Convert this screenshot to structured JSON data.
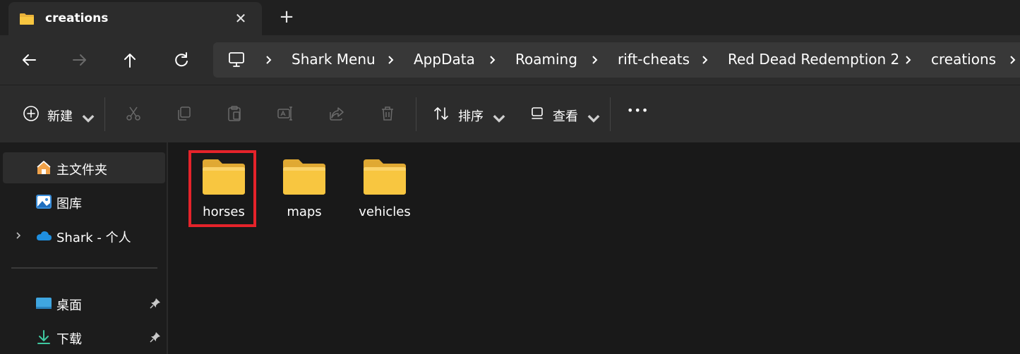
{
  "tab": {
    "title": "creations",
    "close_glyph": "✕",
    "new_tab_glyph": "+"
  },
  "nav": {
    "back_icon": "arrow-left-icon",
    "forward_icon": "arrow-right-icon",
    "up_icon": "arrow-up-icon",
    "refresh_icon": "refresh-icon"
  },
  "breadcrumb": {
    "items": [
      "Shark Menu",
      "AppData",
      "Roaming",
      "rift-cheats",
      "Red Dead Redemption 2",
      "creations"
    ]
  },
  "commands": {
    "new_label": "新建",
    "sort_label": "排序",
    "view_label": "查看",
    "more_glyph": "•••"
  },
  "sidebar": {
    "items": [
      {
        "label": "主文件夹",
        "icon": "home-icon"
      },
      {
        "label": "图库",
        "icon": "gallery-icon"
      },
      {
        "label": "Shark - 个人",
        "icon": "onedrive-icon"
      },
      {
        "label": "桌面",
        "icon": "desktop-icon",
        "pinned": true
      },
      {
        "label": "下载",
        "icon": "download-icon",
        "pinned": true
      }
    ]
  },
  "folders": [
    {
      "name": "horses",
      "highlighted": true
    },
    {
      "name": "maps"
    },
    {
      "name": "vehicles"
    }
  ],
  "colors": {
    "accent_highlight": "#e5232a",
    "folder_yellow": "#f8c640",
    "background": "#1c1c1c"
  }
}
